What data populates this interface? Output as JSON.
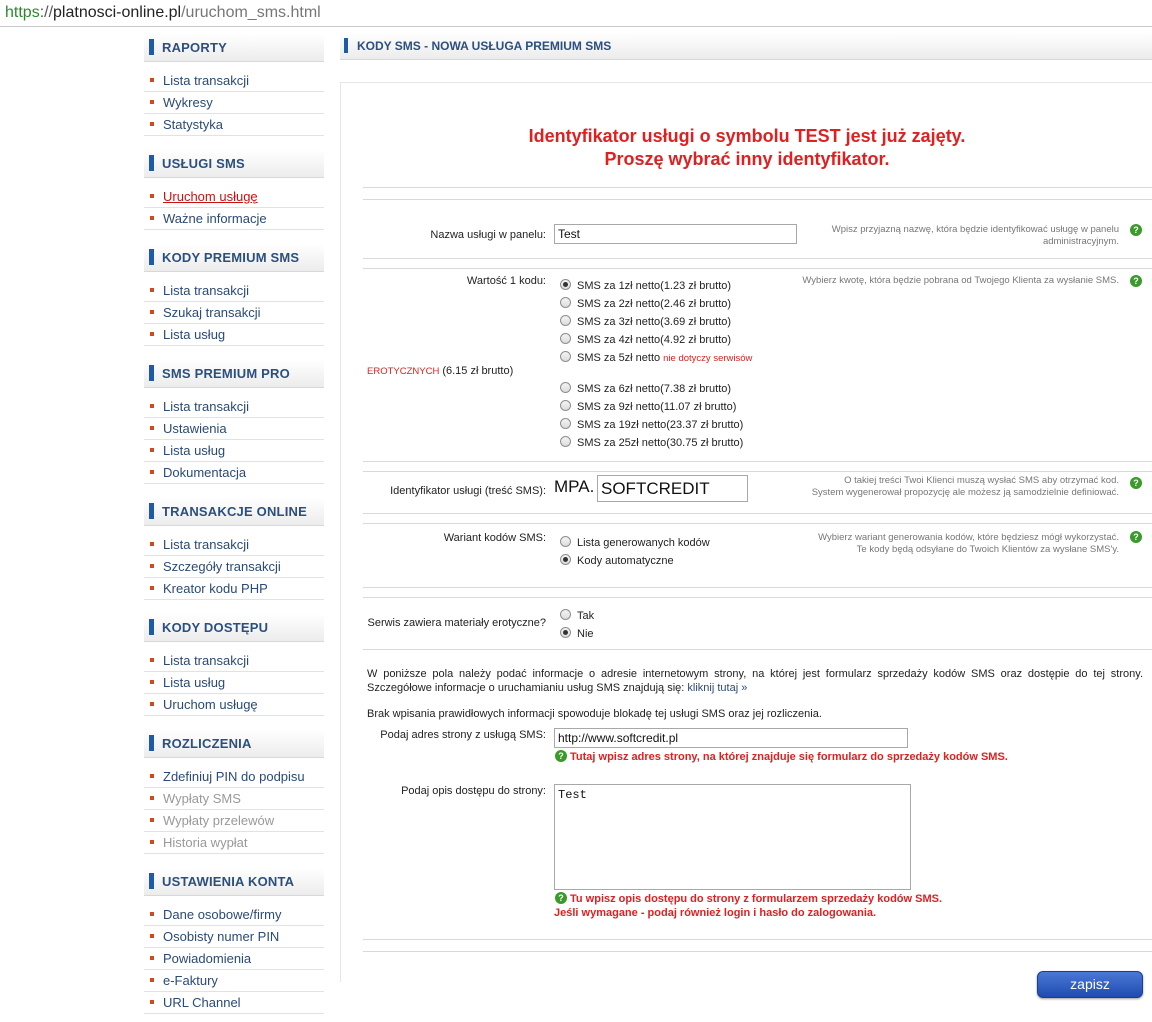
{
  "url": {
    "scheme": "https",
    "sep": "://",
    "host": "platnosci-online.pl",
    "path": "/uruchom_sms.html"
  },
  "sidebar": [
    {
      "title": "RAPORTY",
      "items": [
        {
          "label": "Lista transakcji"
        },
        {
          "label": "Wykresy"
        },
        {
          "label": "Statystyka"
        }
      ]
    },
    {
      "title": "USŁUGI SMS",
      "items": [
        {
          "label": "Uruchom usługę",
          "state": "active"
        },
        {
          "label": "Ważne informacje"
        }
      ]
    },
    {
      "title": "KODY PREMIUM SMS",
      "items": [
        {
          "label": "Lista transakcji"
        },
        {
          "label": "Szukaj transakcji"
        },
        {
          "label": "Lista usług"
        }
      ]
    },
    {
      "title": "SMS PREMIUM PRO",
      "items": [
        {
          "label": "Lista transakcji"
        },
        {
          "label": "Ustawienia"
        },
        {
          "label": "Lista usług"
        },
        {
          "label": "Dokumentacja"
        }
      ]
    },
    {
      "title": "TRANSAKCJE ONLINE",
      "items": [
        {
          "label": "Lista transakcji"
        },
        {
          "label": "Szczegóły transakcji"
        },
        {
          "label": "Kreator kodu PHP"
        }
      ]
    },
    {
      "title": "KODY DOSTĘPU",
      "items": [
        {
          "label": "Lista transakcji"
        },
        {
          "label": "Lista usług"
        },
        {
          "label": "Uruchom usługę"
        }
      ]
    },
    {
      "title": "ROZLICZENIA",
      "items": [
        {
          "label": "Zdefiniuj PIN do podpisu"
        },
        {
          "label": "Wypłaty SMS",
          "state": "disabled"
        },
        {
          "label": "Wypłaty przelewów",
          "state": "disabled"
        },
        {
          "label": "Historia wypłat",
          "state": "disabled"
        }
      ]
    },
    {
      "title": "USTAWIENIA KONTA",
      "items": [
        {
          "label": "Dane osobowe/firmy"
        },
        {
          "label": "Osobisty numer PIN"
        },
        {
          "label": "Powiadomienia"
        },
        {
          "label": "e-Faktury"
        },
        {
          "label": "URL Channel"
        }
      ]
    }
  ],
  "content": {
    "heading": "KODY SMS - NOWA USŁUGA PREMIUM SMS",
    "error_line1": "Identyfikator usługi o symbolu TEST jest już zajęty.",
    "error_line2": "Proszę wybrać inny identyfikator.",
    "name": {
      "label": "Nazwa usługi w panelu:",
      "value": "Test",
      "hint": "Wpisz przyjazną nazwę, która będzie identyfikować usługę w panelu administracyjnym."
    },
    "price": {
      "label": "Wartość 1 kodu:",
      "hint": "Wybierz kwotę, która będzie pobrana od Twojego Klienta za wysłanie SMS.",
      "options": [
        "SMS za 1zł netto(1.23 zł brutto)",
        "SMS za 2zł netto(2.46 zł brutto)",
        "SMS za 3zł netto(3.69 zł brutto)",
        "SMS za 4zł netto(4.92 zł brutto)",
        "SMS za 5zł netto",
        "SMS za 6zł netto(7.38 zł brutto)",
        "SMS za 9zł netto(11.07 zł brutto)",
        "SMS za 19zł netto(23.37 zł brutto)",
        "SMS za 25zł netto(30.75 zł brutto)"
      ],
      "option5_note_a": "nie dotyczy serwisów",
      "option5_note_b": "EROTYCZNYCH",
      "option5_note_c": "(6.15 zł brutto)",
      "selected_index": 0
    },
    "ident": {
      "label": "Identyfikator usługi (treść SMS):",
      "prefix": "MPA.",
      "value": "SOFTCREDIT",
      "hint_line1": "O takiej treści Twoi Klienci muszą wysłać SMS aby otrzymać kod.",
      "hint_line2": "System wygenerował propozycję ale możesz ją samodzielnie definiować."
    },
    "variant": {
      "label": "Wariant kodów SMS:",
      "options": [
        "Lista generowanych kodów",
        "Kody automatyczne"
      ],
      "selected_index": 1,
      "hint_line1": "Wybierz wariant generowania kodów, które będziesz mógł wykorzystać.",
      "hint_line2": "Te kody będą odsyłane do Twoich Klientów za wysłane SMS'y."
    },
    "erotic": {
      "label": "Serwis zawiera materiały erotyczne?",
      "options": [
        "Tak",
        "Nie"
      ],
      "selected_index": 1
    },
    "info_para": "W poniższe pola należy podać informacje o adresie internetowym strony, na której jest formularz sprzedaży kodów SMS oraz dostępie do tej strony. Szczegółowe informacje o uruchamianiu usług SMS znajdują się:",
    "info_link": "kliknij tutaj »",
    "warning_para": "Brak wpisania prawidłowych informacji spowoduje blokadę tej usługi SMS oraz jej rozliczenia.",
    "site_url": {
      "label": "Podaj adres strony z usługą SMS:",
      "value": "http://www.softcredit.pl",
      "note": "Tutaj wpisz adres strony, na której znajduje się formularz do sprzedaży kodów SMS."
    },
    "access": {
      "label": "Podaj opis dostępu do strony:",
      "value": "Test",
      "note_line1": "Tu wpisz opis dostępu do strony z formularzem sprzedaży kodów SMS.",
      "note_line2": "Jeśli wymagane - podaj również login i hasło do zalogowania."
    },
    "help_glyph": "?",
    "save_label": "zapisz"
  }
}
